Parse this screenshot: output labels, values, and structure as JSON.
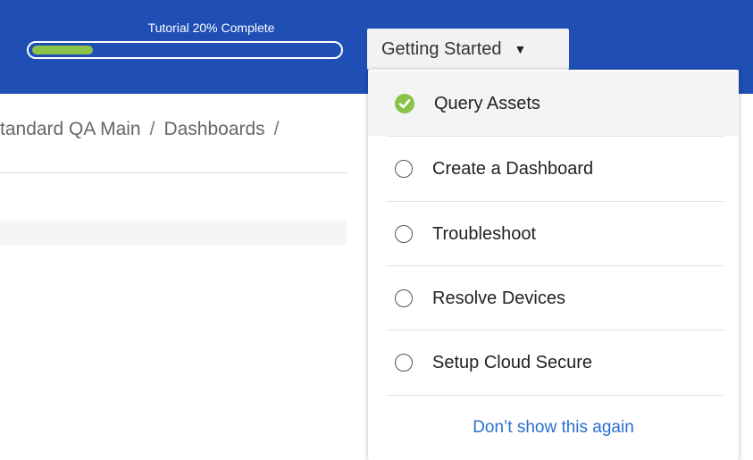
{
  "header": {
    "progress_label": "Tutorial 20% Complete",
    "progress_value": 0.2,
    "menu_button_label": "Getting Started",
    "menu_button_caret": "▼",
    "accent_color": "#1f4fb5",
    "progress_color": "#8bc34a"
  },
  "breadcrumb": {
    "items": [
      "tandard QA Main",
      "Dashboards"
    ],
    "separator": "/"
  },
  "dropdown": {
    "items": [
      {
        "label": "Query Assets",
        "completed": true,
        "icon": "check-circle-icon"
      },
      {
        "label": "Create a Dashboard",
        "completed": false,
        "icon": "empty-circle-icon"
      },
      {
        "label": "Troubleshoot",
        "completed": false,
        "icon": "empty-circle-icon"
      },
      {
        "label": "Resolve Devices",
        "completed": false,
        "icon": "empty-circle-icon"
      },
      {
        "label": "Setup Cloud Secure",
        "completed": false,
        "icon": "empty-circle-icon"
      }
    ],
    "dismiss_link": "Don’t show this again",
    "check_color": "#8bc34a",
    "link_color": "#2a6fd1"
  }
}
